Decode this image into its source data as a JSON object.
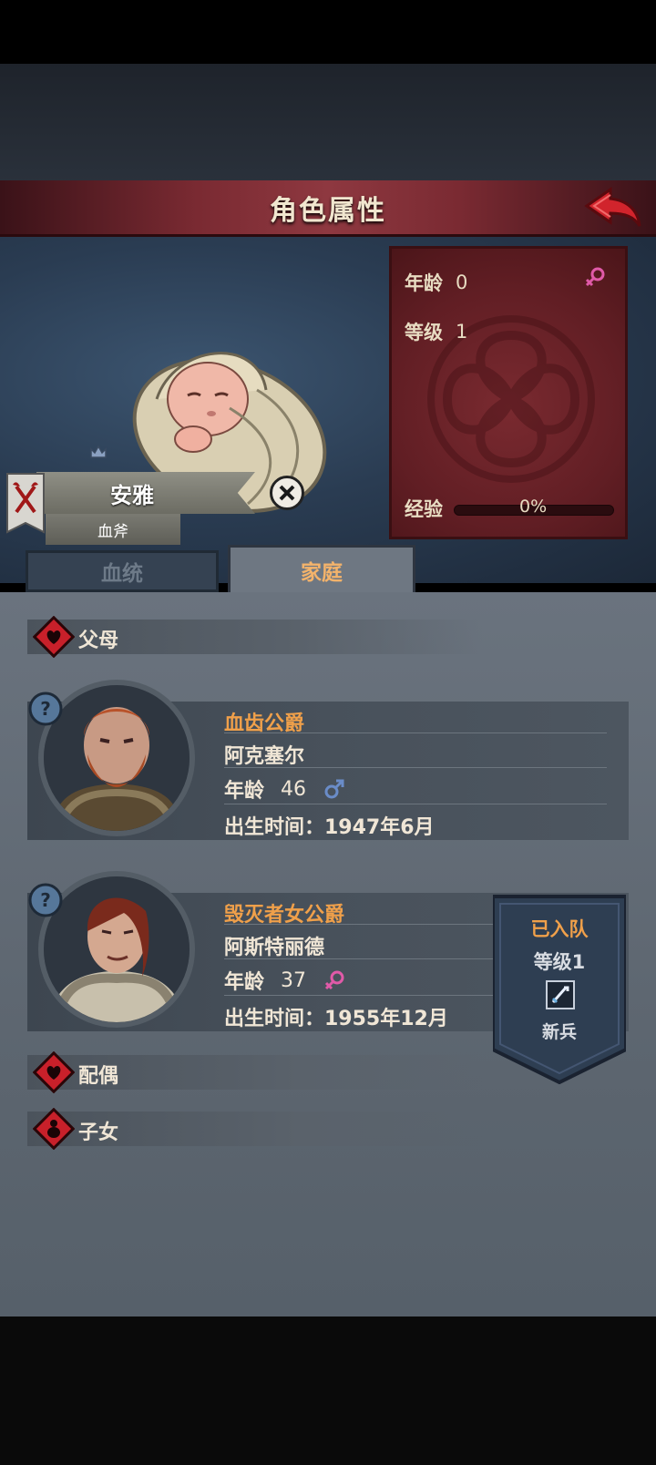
{
  "header": {
    "title": "角色属性"
  },
  "character": {
    "name": "安雅",
    "clan": "血斧",
    "stats": {
      "age_label": "年龄",
      "age_value": "0",
      "level_label": "等级",
      "level_value": "1",
      "exp_label": "经验",
      "exp_value": "0%"
    }
  },
  "tabs": [
    {
      "label": "血统"
    },
    {
      "label": "家庭"
    }
  ],
  "sections": {
    "parents": "父母",
    "spouse": "配偶",
    "children": "子女"
  },
  "members": [
    {
      "title": "血齿公爵",
      "name": "阿克塞尔",
      "age_label": "年龄",
      "age": "46",
      "birth": "出生时间：1947年6月",
      "gender": "male"
    },
    {
      "title": "毁灭者女公爵",
      "name": "阿斯特丽德",
      "age_label": "年龄",
      "age": "37",
      "birth": "出生时间：1955年12月",
      "gender": "female"
    }
  ],
  "team_badge": {
    "status": "已入队",
    "level": "等级1",
    "role": "新兵"
  },
  "colors": {
    "accent_orange": "#f0a04a",
    "banner_red": "#7a2a32",
    "female_pink": "#e05aa8",
    "male_blue": "#6a8cc8"
  }
}
